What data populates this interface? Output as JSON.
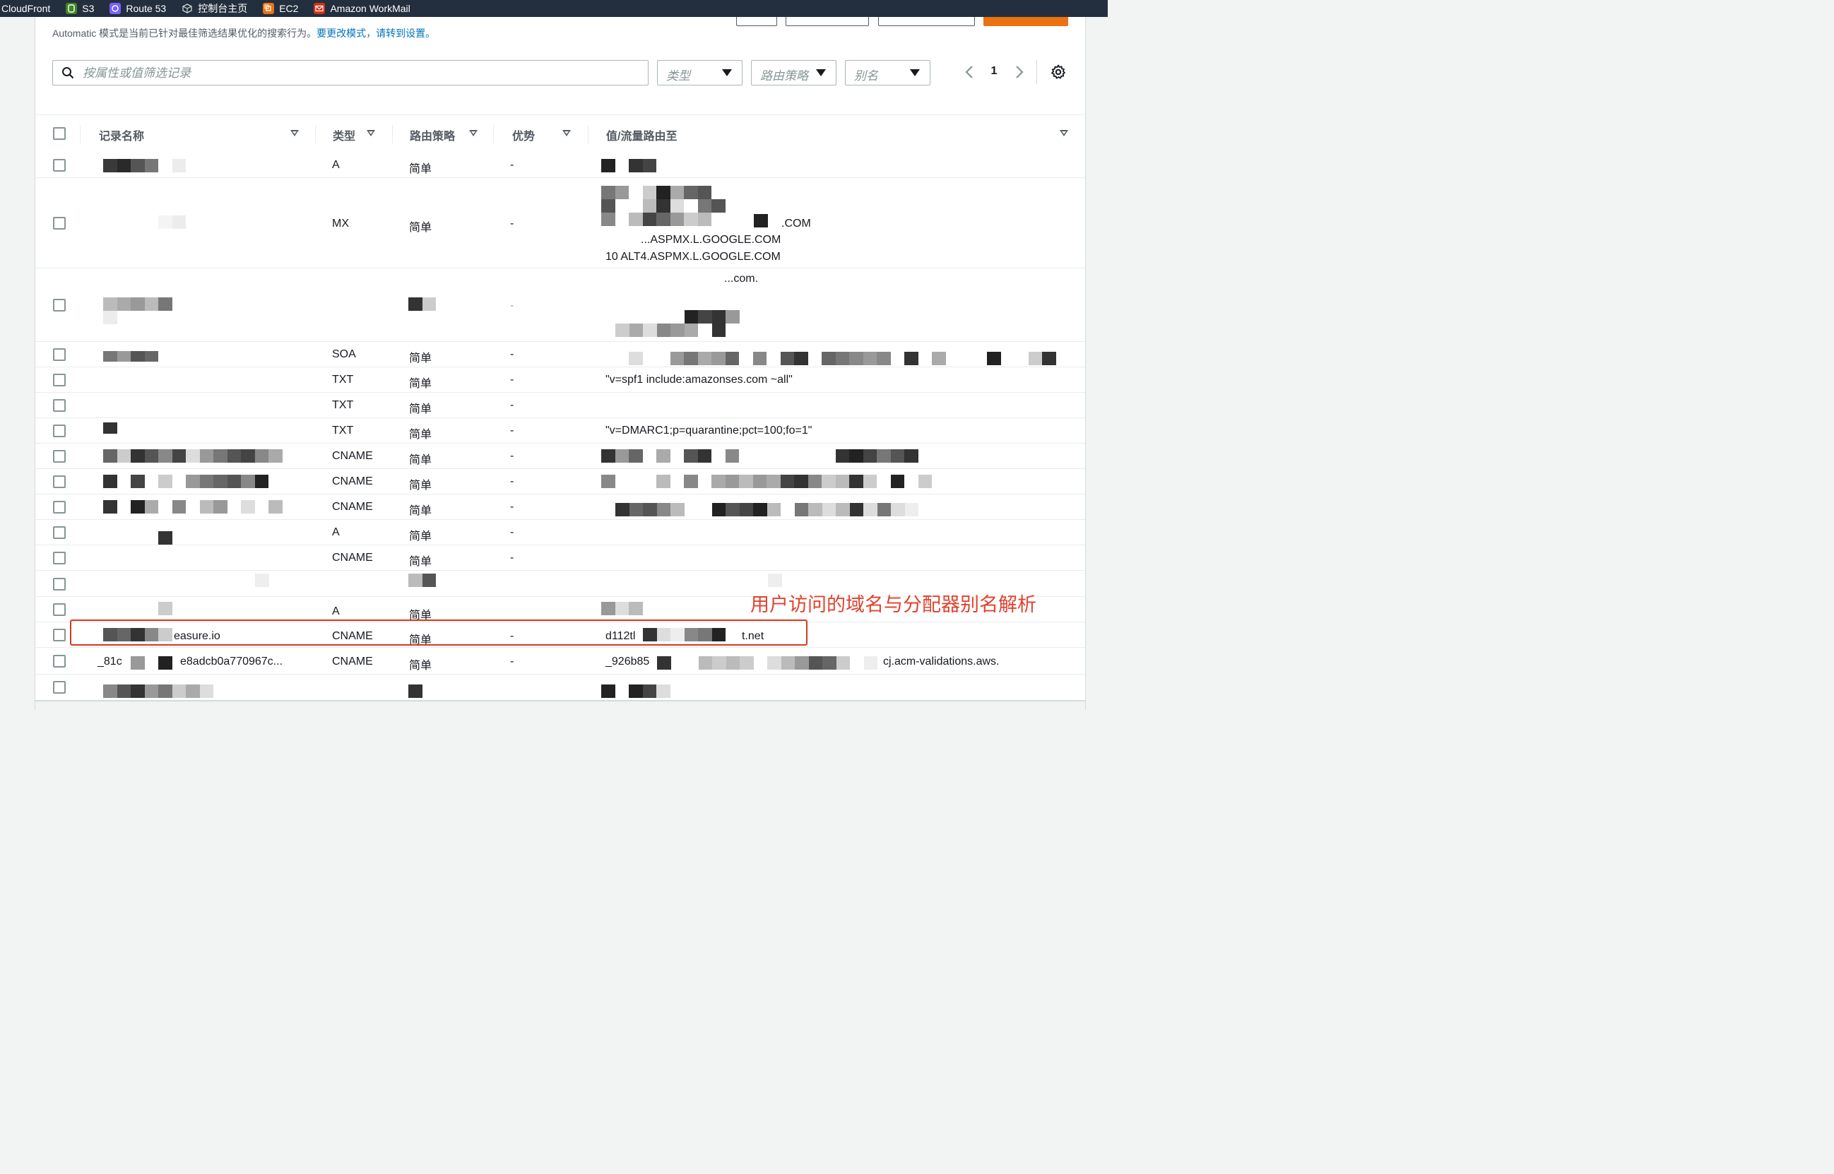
{
  "favorites_bar": {
    "items": [
      {
        "label": "CloudFront",
        "icon": "cloudfront-icon",
        "color": ""
      },
      {
        "label": "S3",
        "icon": "s3-icon",
        "color": "#3f8624"
      },
      {
        "label": "Route 53",
        "icon": "route53-icon",
        "color": "#7b61ff"
      },
      {
        "label": "控制台主页",
        "icon": "console-home-icon",
        "color": "#5f6b7a"
      },
      {
        "label": "EC2",
        "icon": "ec2-icon",
        "color": "#ec7211"
      },
      {
        "label": "Amazon WorkMail",
        "icon": "workmail-icon",
        "color": "#d13212"
      }
    ]
  },
  "notice": {
    "text": "Automatic 模式是当前已针对最佳筛选结果优化的搜索行为。",
    "link": "要更改模式，请转到设置。"
  },
  "filters": {
    "search_placeholder": "按属性或值筛选记录",
    "type_placeholder": "类型",
    "routing_placeholder": "路由策略",
    "alias_placeholder": "别名"
  },
  "pagination": {
    "current_page": "1"
  },
  "table": {
    "columns": [
      "记录名称",
      "类型",
      "路由策略",
      "优势",
      "值/流量路由至"
    ],
    "rows": [
      {
        "name": "",
        "type": "A",
        "policy": "简单",
        "diff": "-",
        "value": []
      },
      {
        "name": "",
        "type": "MX",
        "policy": "简单",
        "diff": "-",
        "value": [
          ".COM",
          "...ASPMX.L.GOOGLE.COM",
          "10 ALT4.ASPMX.L.GOOGLE.COM"
        ]
      },
      {
        "name": "",
        "type": "",
        "policy": "",
        "diff": "-",
        "value": [
          "...com."
        ]
      },
      {
        "name": "",
        "type": "SOA",
        "policy": "简单",
        "diff": "-",
        "value": []
      },
      {
        "name": "",
        "type": "TXT",
        "policy": "简单",
        "diff": "-",
        "value": [
          "\"v=spf1 include:amazonses.com ~all\""
        ]
      },
      {
        "name": "",
        "type": "TXT",
        "policy": "简单",
        "diff": "-",
        "value": []
      },
      {
        "name": "",
        "type": "TXT",
        "policy": "简单",
        "diff": "-",
        "value": [
          "\"v=DMARC1;p=quarantine;pct=100;fo=1\""
        ]
      },
      {
        "name": "",
        "type": "CNAME",
        "policy": "简单",
        "diff": "-",
        "value": []
      },
      {
        "name": "",
        "type": "CNAME",
        "policy": "简单",
        "diff": "-",
        "value": []
      },
      {
        "name": "",
        "type": "CNAME",
        "policy": "简单",
        "diff": "-",
        "value": []
      },
      {
        "name": "",
        "type": "A",
        "policy": "简单",
        "diff": "-",
        "value": []
      },
      {
        "name": "",
        "type": "CNAME",
        "policy": "简单",
        "diff": "-",
        "value": []
      },
      {
        "name": "",
        "type": "",
        "policy": "",
        "diff": "",
        "value": []
      },
      {
        "name": "",
        "type": "A",
        "policy": "简单",
        "diff": "",
        "value": []
      },
      {
        "name": "easure.io",
        "type": "CNAME",
        "policy": "简单",
        "diff": "-",
        "value": [
          "d112tl",
          "t.net"
        ]
      },
      {
        "name": "_81c",
        "name2": "e8adcb0a770967c...",
        "type": "CNAME",
        "policy": "简单",
        "diff": "-",
        "value": [
          "_926b85",
          "cj.acm-validations.aws."
        ]
      },
      {
        "name": "",
        "type": "",
        "policy": "",
        "diff": "",
        "value": []
      }
    ]
  },
  "annotation": {
    "text": "用户访问的域名与分配器别名解析",
    "color": "#e0432e"
  }
}
